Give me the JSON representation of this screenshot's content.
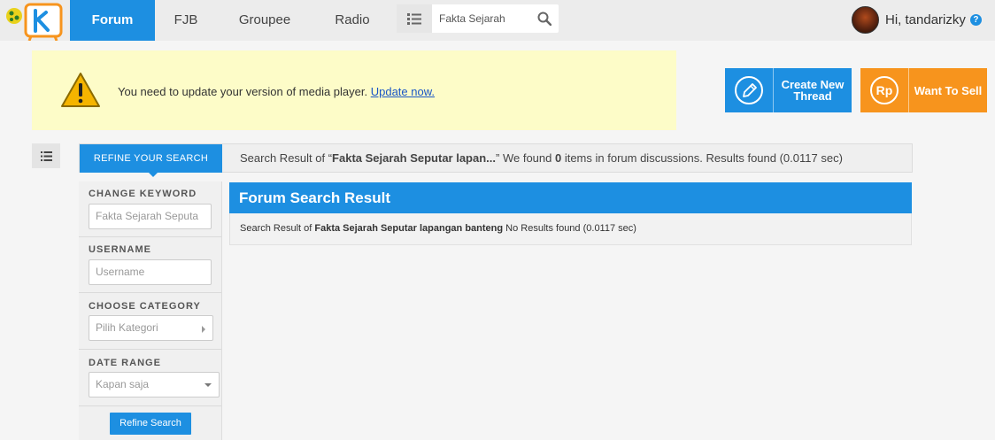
{
  "nav": {
    "tabs": [
      {
        "label": "Forum",
        "active": true
      },
      {
        "label": "FJB",
        "active": false
      },
      {
        "label": "Groupee",
        "active": false
      },
      {
        "label": "Radio",
        "active": false
      }
    ],
    "search_value": "Fakta Sejarah",
    "user_greeting": "Hi, tandarizky",
    "help_glyph": "?"
  },
  "alert": {
    "message": "You need to update your version of media player. ",
    "link": "Update now."
  },
  "actions": {
    "create_thread": "Create New Thread",
    "want_to_sell": "Want To Sell",
    "rp_glyph": "Rp"
  },
  "result_bar": {
    "refine_tab": "REFINE YOUR SEARCH",
    "prefix": "Search Result of “",
    "query_short": "Fakta Sejarah Seputar lapan...",
    "mid": "” We found ",
    "count": "0",
    "suffix": " items in forum discussions. Results found (0.0117 sec)"
  },
  "sidebar": {
    "keyword_title": "CHANGE KEYWORD",
    "keyword_value": "Fakta Sejarah Seputa",
    "username_title": "USERNAME",
    "username_placeholder": "Username",
    "category_title": "CHOOSE CATEGORY",
    "category_value": "Pilih Kategori",
    "date_title": "DATE RANGE",
    "date_value": "Kapan saja",
    "refine_button": "Refine Search"
  },
  "panel": {
    "title": "Forum Search Result",
    "body_prefix": "Search Result of ",
    "body_query": "Fakta Sejarah Seputar lapangan banteng",
    "body_suffix": " No Results found (0.0117 sec)"
  },
  "colors": {
    "primary": "#1d8fe1",
    "orange": "#f7941d",
    "alert_bg": "#fdfcc8"
  },
  "icons": [
    "kaskus-logo",
    "list-icon",
    "search-icon",
    "warning-icon",
    "pencil-icon",
    "rupiah-icon",
    "help-icon"
  ]
}
